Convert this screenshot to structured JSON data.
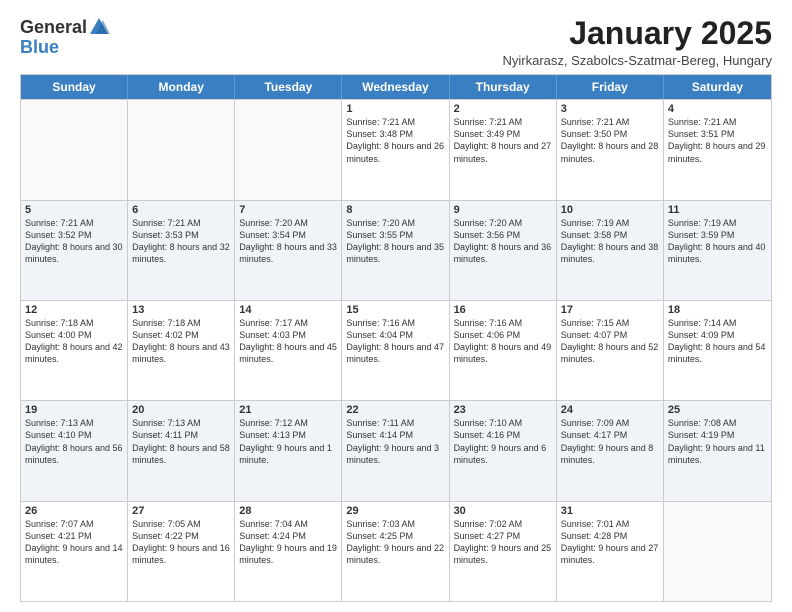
{
  "logo": {
    "general": "General",
    "blue": "Blue"
  },
  "header": {
    "month": "January 2025",
    "location": "Nyirkarasz, Szabolcs-Szatmar-Bereg, Hungary"
  },
  "days": [
    "Sunday",
    "Monday",
    "Tuesday",
    "Wednesday",
    "Thursday",
    "Friday",
    "Saturday"
  ],
  "rows": [
    [
      {
        "day": "",
        "info": ""
      },
      {
        "day": "",
        "info": ""
      },
      {
        "day": "",
        "info": ""
      },
      {
        "day": "1",
        "info": "Sunrise: 7:21 AM\nSunset: 3:48 PM\nDaylight: 8 hours and 26 minutes."
      },
      {
        "day": "2",
        "info": "Sunrise: 7:21 AM\nSunset: 3:49 PM\nDaylight: 8 hours and 27 minutes."
      },
      {
        "day": "3",
        "info": "Sunrise: 7:21 AM\nSunset: 3:50 PM\nDaylight: 8 hours and 28 minutes."
      },
      {
        "day": "4",
        "info": "Sunrise: 7:21 AM\nSunset: 3:51 PM\nDaylight: 8 hours and 29 minutes."
      }
    ],
    [
      {
        "day": "5",
        "info": "Sunrise: 7:21 AM\nSunset: 3:52 PM\nDaylight: 8 hours and 30 minutes."
      },
      {
        "day": "6",
        "info": "Sunrise: 7:21 AM\nSunset: 3:53 PM\nDaylight: 8 hours and 32 minutes."
      },
      {
        "day": "7",
        "info": "Sunrise: 7:20 AM\nSunset: 3:54 PM\nDaylight: 8 hours and 33 minutes."
      },
      {
        "day": "8",
        "info": "Sunrise: 7:20 AM\nSunset: 3:55 PM\nDaylight: 8 hours and 35 minutes."
      },
      {
        "day": "9",
        "info": "Sunrise: 7:20 AM\nSunset: 3:56 PM\nDaylight: 8 hours and 36 minutes."
      },
      {
        "day": "10",
        "info": "Sunrise: 7:19 AM\nSunset: 3:58 PM\nDaylight: 8 hours and 38 minutes."
      },
      {
        "day": "11",
        "info": "Sunrise: 7:19 AM\nSunset: 3:59 PM\nDaylight: 8 hours and 40 minutes."
      }
    ],
    [
      {
        "day": "12",
        "info": "Sunrise: 7:18 AM\nSunset: 4:00 PM\nDaylight: 8 hours and 42 minutes."
      },
      {
        "day": "13",
        "info": "Sunrise: 7:18 AM\nSunset: 4:02 PM\nDaylight: 8 hours and 43 minutes."
      },
      {
        "day": "14",
        "info": "Sunrise: 7:17 AM\nSunset: 4:03 PM\nDaylight: 8 hours and 45 minutes."
      },
      {
        "day": "15",
        "info": "Sunrise: 7:16 AM\nSunset: 4:04 PM\nDaylight: 8 hours and 47 minutes."
      },
      {
        "day": "16",
        "info": "Sunrise: 7:16 AM\nSunset: 4:06 PM\nDaylight: 8 hours and 49 minutes."
      },
      {
        "day": "17",
        "info": "Sunrise: 7:15 AM\nSunset: 4:07 PM\nDaylight: 8 hours and 52 minutes."
      },
      {
        "day": "18",
        "info": "Sunrise: 7:14 AM\nSunset: 4:09 PM\nDaylight: 8 hours and 54 minutes."
      }
    ],
    [
      {
        "day": "19",
        "info": "Sunrise: 7:13 AM\nSunset: 4:10 PM\nDaylight: 8 hours and 56 minutes."
      },
      {
        "day": "20",
        "info": "Sunrise: 7:13 AM\nSunset: 4:11 PM\nDaylight: 8 hours and 58 minutes."
      },
      {
        "day": "21",
        "info": "Sunrise: 7:12 AM\nSunset: 4:13 PM\nDaylight: 9 hours and 1 minute."
      },
      {
        "day": "22",
        "info": "Sunrise: 7:11 AM\nSunset: 4:14 PM\nDaylight: 9 hours and 3 minutes."
      },
      {
        "day": "23",
        "info": "Sunrise: 7:10 AM\nSunset: 4:16 PM\nDaylight: 9 hours and 6 minutes."
      },
      {
        "day": "24",
        "info": "Sunrise: 7:09 AM\nSunset: 4:17 PM\nDaylight: 9 hours and 8 minutes."
      },
      {
        "day": "25",
        "info": "Sunrise: 7:08 AM\nSunset: 4:19 PM\nDaylight: 9 hours and 11 minutes."
      }
    ],
    [
      {
        "day": "26",
        "info": "Sunrise: 7:07 AM\nSunset: 4:21 PM\nDaylight: 9 hours and 14 minutes."
      },
      {
        "day": "27",
        "info": "Sunrise: 7:05 AM\nSunset: 4:22 PM\nDaylight: 9 hours and 16 minutes."
      },
      {
        "day": "28",
        "info": "Sunrise: 7:04 AM\nSunset: 4:24 PM\nDaylight: 9 hours and 19 minutes."
      },
      {
        "day": "29",
        "info": "Sunrise: 7:03 AM\nSunset: 4:25 PM\nDaylight: 9 hours and 22 minutes."
      },
      {
        "day": "30",
        "info": "Sunrise: 7:02 AM\nSunset: 4:27 PM\nDaylight: 9 hours and 25 minutes."
      },
      {
        "day": "31",
        "info": "Sunrise: 7:01 AM\nSunset: 4:28 PM\nDaylight: 9 hours and 27 minutes."
      },
      {
        "day": "",
        "info": ""
      }
    ]
  ]
}
